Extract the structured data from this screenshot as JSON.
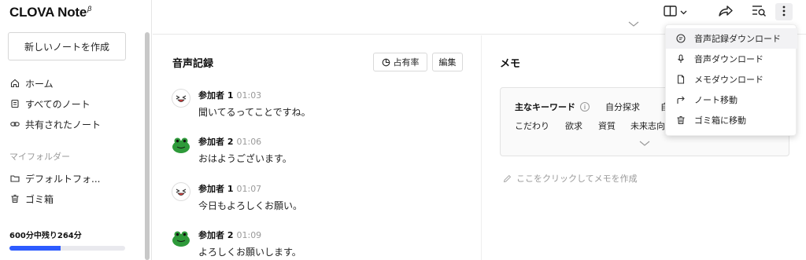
{
  "app": {
    "logo": "CLOVA Note",
    "logo_sup": "β"
  },
  "sidebar": {
    "new_note": "新しいノートを作成",
    "nav": [
      {
        "label": "ホーム",
        "icon": "home-icon"
      },
      {
        "label": "すべてのノート",
        "icon": "document-icon"
      },
      {
        "label": "共有されたノート",
        "icon": "link-icon"
      }
    ],
    "folders_label": "マイフォルダー",
    "folders": [
      {
        "label": "デフォルトフォ...",
        "icon": "folder-icon"
      },
      {
        "label": "ゴミ箱",
        "icon": "trash-icon"
      }
    ],
    "usage": {
      "text": "600分中残り264分",
      "fraction": 0.44
    }
  },
  "transcript": {
    "title": "音声記録",
    "share_button": "占有率",
    "edit_button": "編集",
    "utterances": [
      {
        "speaker": "参加者 1",
        "time": "01:03",
        "text": "聞いてるってことですね。",
        "avatar": "ghost"
      },
      {
        "speaker": "参加者 2",
        "time": "01:06",
        "text": "おはようございます。",
        "avatar": "frog"
      },
      {
        "speaker": "参加者 1",
        "time": "01:07",
        "text": "今日もよろしくお願い。",
        "avatar": "ghost"
      },
      {
        "speaker": "参加者 2",
        "time": "01:09",
        "text": "よろしくお願いします。",
        "avatar": "frog"
      }
    ]
  },
  "memo": {
    "title": "メモ",
    "keywords_label": "主なキーワード",
    "keywords_info": "i",
    "keywords_row1": [
      "自分探求",
      "自"
    ],
    "keywords_row2": [
      "こだわり",
      "欲求",
      "資質",
      "未来志向"
    ],
    "placeholder": "ここをクリックしてメモを作成"
  },
  "menu": {
    "items": [
      {
        "label": "音声記録ダウンロード",
        "icon": "transcript-download-icon",
        "active": true
      },
      {
        "label": "音声ダウンロード",
        "icon": "microphone-icon",
        "active": false
      },
      {
        "label": "メモダウンロード",
        "icon": "memo-file-icon",
        "active": false
      },
      {
        "label": "ノート移動",
        "icon": "move-arrow-icon",
        "active": false
      },
      {
        "label": "ゴミ箱に移動",
        "icon": "trash-icon",
        "active": false
      }
    ]
  },
  "colors": {
    "accent": "#2d5bff",
    "frog": "#2e9a3a"
  }
}
